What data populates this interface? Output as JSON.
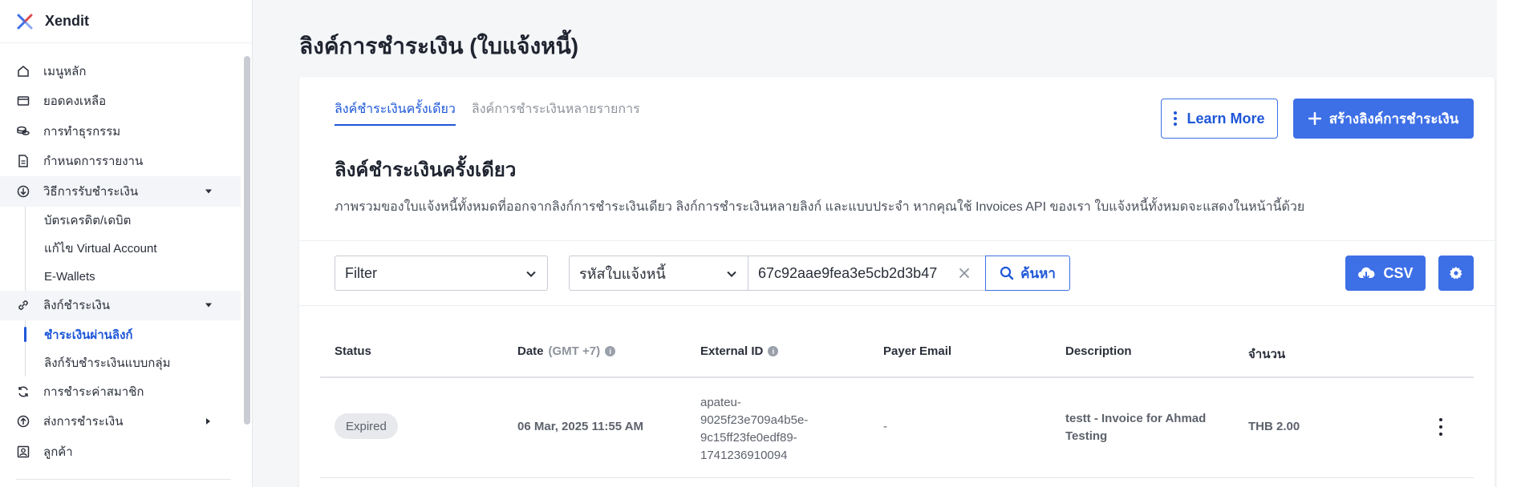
{
  "brand": {
    "name": "Xendit"
  },
  "sidebar": {
    "items": [
      {
        "label": "เมนูหลัก",
        "icon": "home-icon"
      },
      {
        "label": "ยอดคงเหลือ",
        "icon": "wallet-icon"
      },
      {
        "label": "การทำธุรกรรม",
        "icon": "coins-icon"
      },
      {
        "label": "กำหนดการรายงาน",
        "icon": "document-icon"
      },
      {
        "label": "วิธีการรับชำระเงิน",
        "icon": "download-circle-icon",
        "expanded": true
      },
      {
        "label": "ลิงก์ชำระเงิน",
        "icon": "link-icon",
        "expanded": true
      },
      {
        "label": "การชำระค่าสมาชิก",
        "icon": "refresh-icon"
      },
      {
        "label": "ส่งการชำระเงิน",
        "icon": "upload-circle-icon"
      },
      {
        "label": "ลูกค้า",
        "icon": "user-badge-icon"
      }
    ],
    "payment_methods_sub": [
      "บัตรเครดิต/เดบิต",
      "แก้ไข Virtual Account",
      "E-Wallets"
    ],
    "payment_links_sub": [
      "ชำระเงินผ่านลิงก์",
      "ลิงก์รับชำระเงินแบบกลุ่ม"
    ]
  },
  "page": {
    "title": "ลิงค์การชำระเงิน (ใบแจ้งหนี้)",
    "tabs": [
      "ลิงค์ชำระเงินครั้งเดียว",
      "ลิงค์การชำระเงินหลายรายการ"
    ],
    "learn_more": "Learn More",
    "create_button": "สร้างลิงค์การชำระเงิน",
    "section_title": "ลิงค์ชำระเงินครั้งเดียว",
    "section_desc": "ภาพรวมของใบแจ้งหนี้ทั้งหมดที่ออกจากลิงก์การชำระเงินเดียว ลิงก์การชำระเงินหลายลิงก์ และแบบประจำ หากคุณใช้ Invoices API ของเรา ใบแจ้งหนี้ทั้งหมดจะแสดงในหน้านี้ด้วย"
  },
  "filters": {
    "filter_value": "Filter",
    "field_value": "รหัสใบแจ้งหนี้",
    "search_value": "67c92aae9fea3e5cb2d3b47",
    "search_button": "ค้นหา",
    "csv_button": "CSV"
  },
  "table": {
    "headers": {
      "status": "Status",
      "date": "Date",
      "date_tz": "(GMT +7)",
      "external_id": "External ID",
      "payer_email": "Payer Email",
      "description": "Description",
      "amount": "จำนวน"
    },
    "rows": [
      {
        "status": "Expired",
        "date": "06 Mar, 2025 11:55 AM",
        "external_id_lines": [
          "apateu-",
          "9025f23e709a4b5e-",
          "9c15ff23fe0edf89-",
          "1741236910094"
        ],
        "payer_email": "-",
        "description_lines": [
          "testt - Invoice for Ahmad",
          "Testing"
        ],
        "amount": "THB 2.00"
      }
    ]
  },
  "colors": {
    "primary": "#3d6fe6",
    "active_link": "#1e57d8"
  }
}
